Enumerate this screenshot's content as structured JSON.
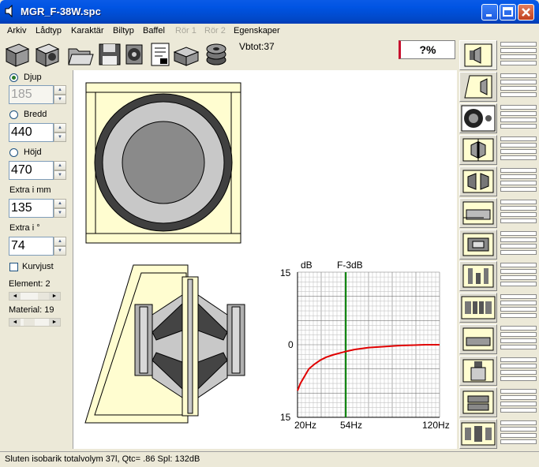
{
  "window": {
    "title": "MGR_F-38W.spc"
  },
  "menu": {
    "items": [
      "Arkiv",
      "Lådtyp",
      "Karaktär",
      "Biltyp",
      "Baffel",
      "Rör 1",
      "Rör 2",
      "Egenskaper"
    ],
    "disabled": [
      "Rör 1",
      "Rör 2"
    ]
  },
  "toolbar": {
    "icons": [
      "new-box-icon",
      "open-box-icon",
      "folder-open-icon",
      "save-disk-icon",
      "driver-settings-icon",
      "document-report-icon",
      "print-box-icon",
      "speaker-stack-icon"
    ],
    "vbtot": "Vbtot:37",
    "percent": "?%"
  },
  "left_panel": {
    "radio_djup": "Djup",
    "djup_value": "185",
    "radio_bredd": "Bredd",
    "bredd_value": "440",
    "radio_hojd": "Höjd",
    "hojd_value": "470",
    "extra_mm_label": "Extra i mm",
    "extra_mm_value": "135",
    "extra_deg_label": "Extra i °",
    "extra_deg_value": "74",
    "kurvjust_label": "Kurvjust",
    "element_label": "Element: 2",
    "material_label": "Material: 19"
  },
  "graph": {
    "title": "F-3dB",
    "ylabel": "dB",
    "y_top": "15",
    "y_mid": "0",
    "y_bottom": "15",
    "x_left": "20Hz",
    "x_mid": "54Hz",
    "x_right": "120Hz",
    "colors": {
      "curve": "#e00000",
      "marker": "#008000"
    }
  },
  "chart_data": {
    "type": "line",
    "title": "F-3dB",
    "ylabel": "dB",
    "ylim": [
      -15,
      15
    ],
    "x_tick_labels": [
      "20Hz",
      "54Hz",
      "120Hz"
    ],
    "marker_x": 54,
    "series": [
      {
        "x": [
          20,
          22,
          25,
          28,
          32,
          36,
          40,
          45,
          50,
          54,
          60,
          70,
          80,
          90,
          100,
          110,
          120
        ],
        "values": [
          -9.5,
          -8,
          -6.5,
          -5,
          -4,
          -3.2,
          -2.6,
          -2.1,
          -1.7,
          -1.4,
          -1.0,
          -0.6,
          -0.4,
          -0.2,
          -0.1,
          0,
          0
        ]
      }
    ]
  },
  "right_panel": {
    "shapes": [
      "sealed-box-icon",
      "bandpass-angled-icon",
      "round-driver-icon",
      "dual-chamber-icon",
      "isobarik-icon",
      "ported-box-icon",
      "double-port-icon",
      "push-pull-icon",
      "quad-driver-icon",
      "slot-port-icon",
      "clamshell-icon",
      "isobarik-ported-icon",
      "compound-icon"
    ]
  },
  "status": {
    "text": "Sluten isobarik totalvolym 37l, Qtc= .86 Spl: 132dB"
  }
}
